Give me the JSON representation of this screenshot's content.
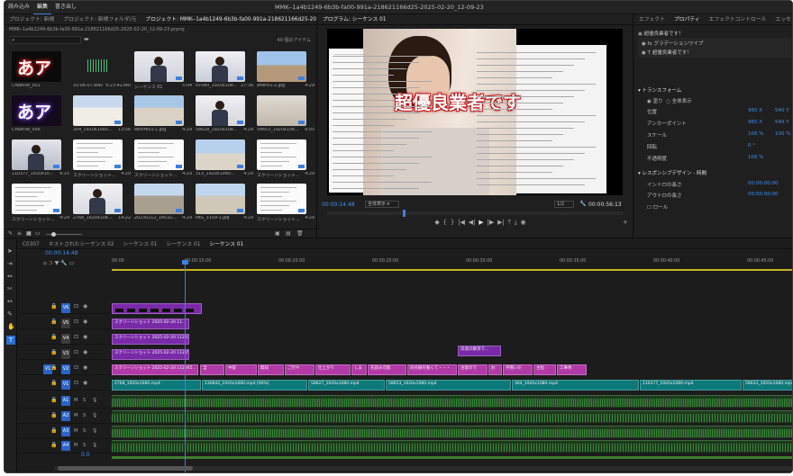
{
  "menubar": {
    "items": [
      "読み込み",
      "編集",
      "書き出し"
    ]
  },
  "window_title": "MMK--1a4b1249-6b3b-fa00-991a-218621166d25-2025-02-20_12-09-23",
  "project_panel": {
    "tabs": [
      "プロジェクト: 新規",
      "プロジェクト: 新規フォルダ/元",
      "プロジェクト: MMK--1a4b1249-6b3b-fa00-991a-218621166d25-2025-02-20_12-09-23"
    ],
    "path": "MMK--1a4b1249-6b3b-fa00-991a-218621166d25-2025-02-20_12-09-23.prproj",
    "item_count": "40 個のアイテム",
    "items": [
      {
        "name": "Creative_001",
        "dur": "",
        "kind": "title-red"
      },
      {
        "name": "10-06-07.wav",
        "dur": "6:23:42340",
        "kind": "audio"
      },
      {
        "name": "シーケンス 01",
        "dur": "5:04",
        "kind": "person"
      },
      {
        "name": "07080_1920x108...",
        "dur": "27:38",
        "kind": "person2"
      },
      {
        "name": "after01-2.jpg",
        "dur": "4:29",
        "kind": "building"
      },
      {
        "name": "Creative_006",
        "dur": "",
        "kind": "title-purple"
      },
      {
        "name": "304_1920x1080...",
        "dur": "13:56",
        "kind": "building2"
      },
      {
        "name": "before01-1.jpg",
        "dur": "4:29",
        "kind": "building3"
      },
      {
        "name": "58628_1920x108...",
        "dur": "4:29",
        "kind": "person3"
      },
      {
        "name": "58653_1920x108...",
        "dur": "6:05",
        "kind": "room"
      },
      {
        "name": "110377_1920x10...",
        "dur": "6:15",
        "kind": "person4"
      },
      {
        "name": "スクリーンショット...",
        "dur": "4:29",
        "kind": "doc"
      },
      {
        "name": "スクリーンショット...",
        "dur": "4:29",
        "kind": "doc"
      },
      {
        "name": "313_1920x1080...",
        "dur": "4:29",
        "kind": "building4"
      },
      {
        "name": "スクリーンショット...",
        "dur": "4:29",
        "kind": "doc"
      },
      {
        "name": "スクリーンショット...",
        "dur": "4:29",
        "kind": "doc"
      },
      {
        "name": "2768_1920x108...",
        "dur": "14:22",
        "kind": "person5"
      },
      {
        "name": "20230212_14532...",
        "dur": "4:29",
        "kind": "building5"
      },
      {
        "name": "IMG_3159-1.jpg",
        "dur": "4:29",
        "kind": "building6"
      },
      {
        "name": "スクリーンショット...",
        "dur": "4:29",
        "kind": "doc"
      }
    ]
  },
  "program_monitor": {
    "tab": "プログラム: シーケンス 01",
    "overlay_text": "超優良業者です",
    "timecode": "00:00:14:48",
    "fit": "全体表示",
    "quality": "1/2",
    "duration": "00:00:56:13"
  },
  "effects_panel": {
    "tabs": [
      "エフェクト",
      "プロパティ",
      "エフェクトコントロール",
      "エッセンシャル"
    ],
    "layer1": "超優良業者です！",
    "layer2": "グラデーションワイプ",
    "layer3": "超優良業者です！",
    "transform_title": "トランスフォーム",
    "rows": [
      {
        "label": "位置",
        "v1": "960 X",
        "v2": "540 Y"
      },
      {
        "label": "アンカーポイント",
        "v1": "960 X",
        "v2": "540 Y"
      },
      {
        "label": "スケール",
        "v1": "100 %",
        "v2": "100 %"
      },
      {
        "label": "回転",
        "v1": "0 °",
        "v2": ""
      },
      {
        "label": "不透明度",
        "v1": "100 %",
        "v2": ""
      }
    ],
    "fit_label": "塗り",
    "fit_opt": "全体表示",
    "responsive_title": "レスポンシブデザイン - 時間",
    "intro": {
      "label": "イントロの長さ",
      "v": "00:00:00:00"
    },
    "outro": {
      "label": "アウトロの長さ",
      "v": "00:00:00:00"
    },
    "roll": "ロール"
  },
  "timeline": {
    "tabs": [
      "C0307",
      "ネストされたシーケンス 02",
      "シーケンス 01",
      "シーケンス 01",
      "シーケンス 01"
    ],
    "timecode": "00:00:14:48",
    "ruler": [
      "00:00",
      "00:00:15:00",
      "00:00:20:00",
      "00:00:25:00",
      "00:00:30:00",
      "00:00:35:00",
      "00:00:40:00",
      "00:00:45:00"
    ],
    "tracks_video": [
      "V6",
      "V5",
      "V4",
      "V3",
      "V2",
      "V1"
    ],
    "tracks_audio": [
      "A1",
      "A2",
      "A3",
      "A4"
    ],
    "mix_value": "0.0",
    "clips": {
      "v5": "スクリーンショット 2025-02-20 11...",
      "v4": "スクリーンショット 2025-02-20 112926...",
      "v3a": "スクリーンショット 2025-02-20 112859...",
      "v3b": "伝達の解消で...",
      "v2a": "スクリーンショット 2025-02-20 112945...",
      "v1a": "2768_1920x1080.mp4",
      "v1b": "130842_1920x1080.mp4 [90%]",
      "v1c": "58627_1920x1080.mp4",
      "v1d": "58653_1920x1080.mp4",
      "v1e": "304_1920x1080.mp4",
      "v1f": "110377_1920x1080.mp4",
      "v1g": "58633_1920x1080.mp4",
      "v2labels": [
        "当",
        "中提",
        "無知",
        "ご行や",
        "仕上がり",
        "しま",
        "先読み可能",
        "同点線を動くて・・・",
        "注意ので",
        "お",
        "手際いだ",
        "主粒",
        "工事余"
      ]
    }
  },
  "colors": {
    "accent": "#3f7fe0",
    "clip_purple": "#7a2aa8",
    "clip_magenta": "#b23aa8",
    "clip_teal": "#0d7a7a",
    "audio_green": "#3a8a3a"
  }
}
